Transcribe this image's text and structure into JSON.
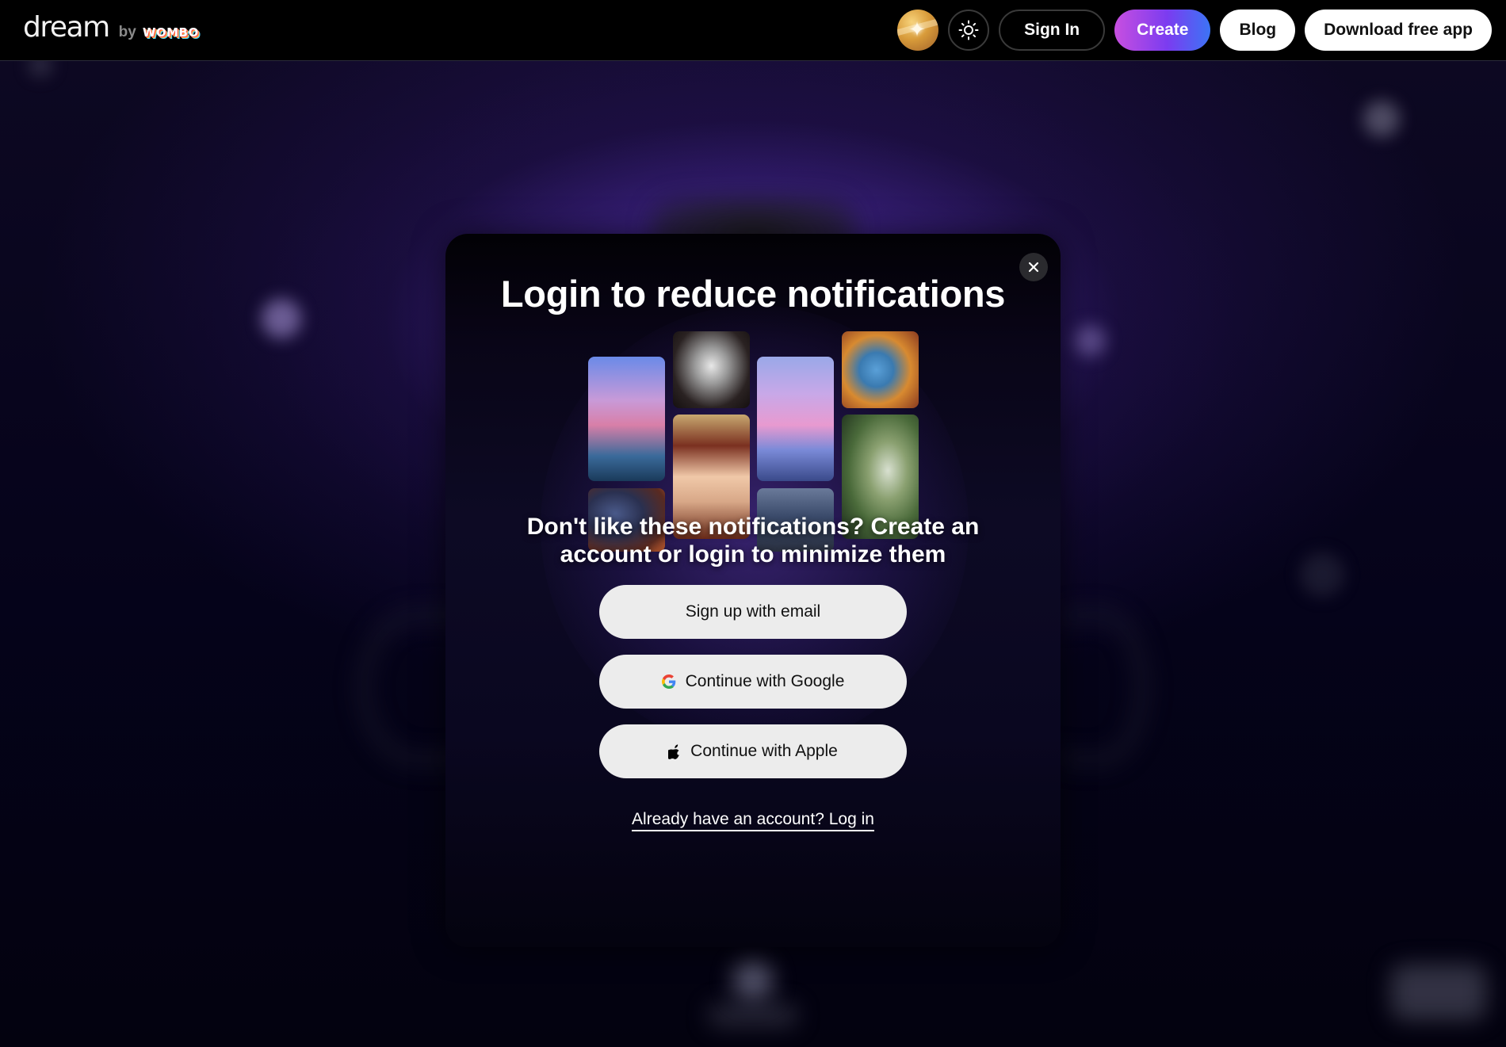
{
  "header": {
    "logo": {
      "brand": "dream",
      "by": "by",
      "partner": "WOMBO"
    },
    "avatar_icon": "sparkle-avatar-icon",
    "theme_toggle_icon": "sun-icon",
    "sign_in_label": "Sign In",
    "create_label": "Create",
    "blog_label": "Blog",
    "download_label": "Download free app"
  },
  "modal": {
    "title": "Login to reduce notifications",
    "close_icon": "close-icon",
    "gallery": [
      {
        "name": "fantasy-castle",
        "colors": [
          "#6a7de0",
          "#d98fc0",
          "#2c5e8a"
        ]
      },
      {
        "name": "winged-angel-robot",
        "colors": [
          "#1a1414",
          "#d8d8d8",
          "#4a4040"
        ]
      },
      {
        "name": "pink-tree-river",
        "colors": [
          "#9aa8e8",
          "#e8a0d8",
          "#4a5aa0"
        ]
      },
      {
        "name": "blue-goddess",
        "colors": [
          "#e08a30",
          "#4a9ad0",
          "#8a3020"
        ]
      },
      {
        "name": "anime-girl-rose",
        "colors": [
          "#7a3020",
          "#f0c8a8",
          "#c87850"
        ]
      },
      {
        "name": "forest-lady-lilypads",
        "colors": [
          "#4a6a3a",
          "#c8d8c0",
          "#2a4030"
        ]
      },
      {
        "name": "hooded-figure",
        "colors": [
          "#1a2a4a",
          "#4a5a8a",
          "#c86030"
        ]
      },
      {
        "name": "floating-island",
        "colors": [
          "#2a3a5a",
          "#6a7a9a",
          "#c0a080"
        ]
      }
    ],
    "subtitle_line1": "Don't like these notifications? Create an",
    "subtitle_line2": "account or login to minimize them",
    "buttons": {
      "email": {
        "label": "Sign up with email"
      },
      "google": {
        "label": "Continue with Google",
        "icon": "google-icon"
      },
      "apple": {
        "label": "Continue with Apple",
        "icon": "apple-icon"
      }
    },
    "login_link": "Already have an account? Log in"
  },
  "colors": {
    "create_gradient_start": "#c84fe0",
    "create_gradient_end": "#3c74f5",
    "background_glow": "#5a3cb4",
    "button_bg": "#ececec"
  }
}
